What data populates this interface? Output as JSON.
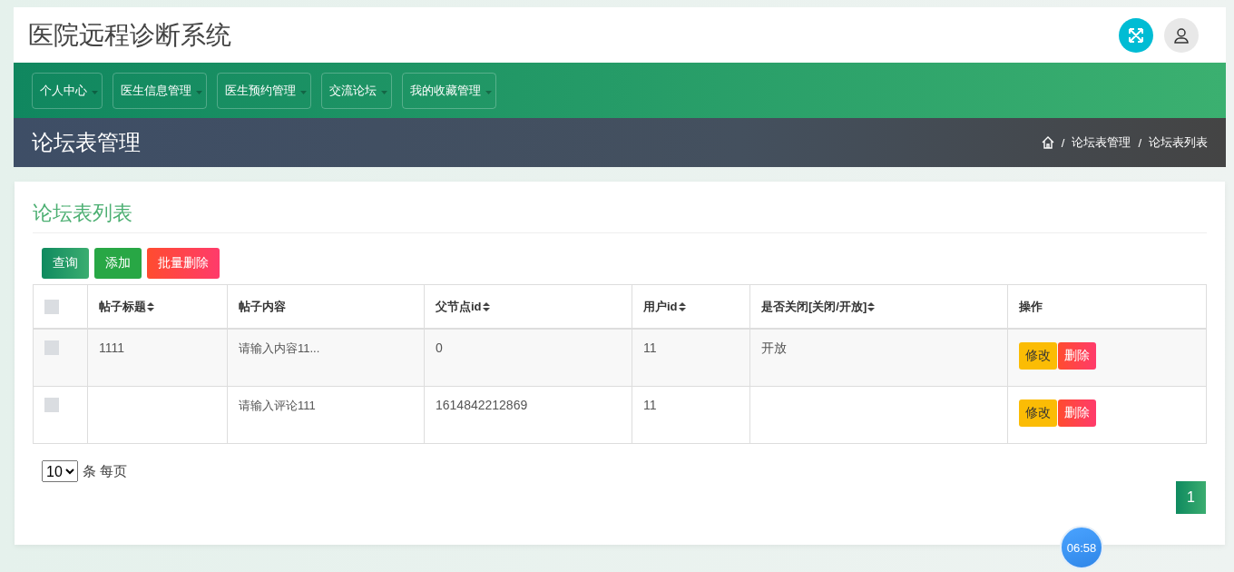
{
  "header": {
    "title": "医院远程诊断系统"
  },
  "nav": [
    {
      "label": "个人中心"
    },
    {
      "label": "医生信息管理"
    },
    {
      "label": "医生预约管理"
    },
    {
      "label": "交流论坛"
    },
    {
      "label": "我的收藏管理"
    }
  ],
  "banner": {
    "title": "论坛表管理",
    "breadcrumb_separator": "/",
    "breadcrumb": [
      "论坛表管理",
      "论坛表列表"
    ]
  },
  "card": {
    "title": "论坛表列表",
    "toolbar": [
      {
        "label": "查询",
        "kind": "search"
      },
      {
        "label": "添加",
        "kind": "add"
      },
      {
        "label": "批量删除",
        "kind": "delete"
      }
    ]
  },
  "table": {
    "select_all": {
      "checked": false
    },
    "columns": [
      {
        "label": "帖子标题",
        "sortable": true
      },
      {
        "label": "帖子内容",
        "sortable": false
      },
      {
        "label": "父节点id",
        "sortable": true
      },
      {
        "label": "用户id",
        "sortable": true
      },
      {
        "label": "是否关闭[关闭/开放]",
        "sortable": true
      },
      {
        "label": "操作",
        "sortable": false
      }
    ],
    "rows": [
      {
        "checked": false,
        "cells": [
          "1111",
          "请输入内容11...",
          "0",
          "11",
          "开放"
        ],
        "actions": [
          "修改",
          "删除"
        ]
      },
      {
        "checked": false,
        "cells": [
          "",
          "请输入评论111",
          "1614842212869",
          "11",
          ""
        ],
        "actions": [
          "修改",
          "删除"
        ]
      }
    ]
  },
  "pager": {
    "page_size": "10",
    "suffix": "条 每页",
    "pages": [
      {
        "label": "1",
        "selected": true
      }
    ]
  },
  "timer": "06:58"
}
